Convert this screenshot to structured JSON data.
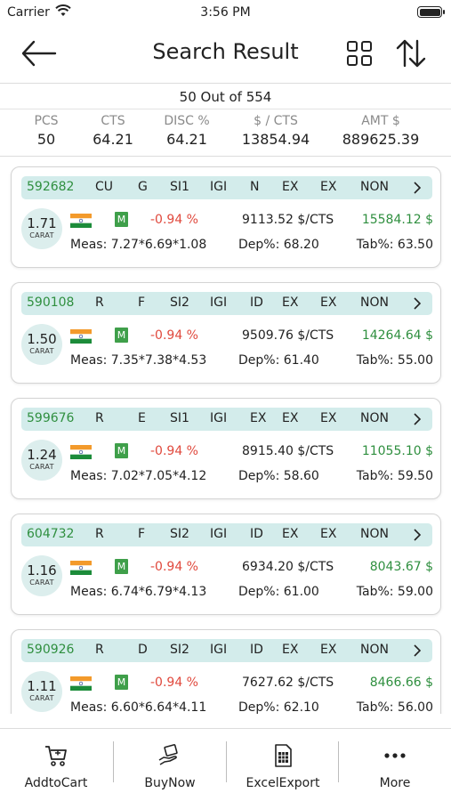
{
  "status_bar": {
    "carrier": "Carrier",
    "time": "3:56 PM"
  },
  "header": {
    "title": "Search Result"
  },
  "summary": {
    "count_text": "50 Out of 554",
    "stats": [
      {
        "label": "PCS",
        "value": "50"
      },
      {
        "label": "CTS",
        "value": "64.21"
      },
      {
        "label": "DISC %",
        "value": "64.21"
      },
      {
        "label": "$ / CTS",
        "value": "13854.94"
      },
      {
        "label": "AMT $",
        "value": "889625.39"
      }
    ]
  },
  "results": [
    {
      "stock": "592682",
      "shape": "CU",
      "color": "G",
      "clarity": "SI1",
      "lab": "IGI",
      "cut": "N",
      "polish": "EX",
      "symmetry": "EX",
      "fluorescence": "NON",
      "carat": "1.71",
      "carat_unit": "CARAT",
      "badge": "M",
      "discount": "-0.94 %",
      "price_per_carat": "9113.52 $/CTS",
      "amount": "15584.12 $",
      "measurements": "Meas: 7.27*6.69*1.08",
      "depth": "Dep%: 68.20",
      "table": "Tab%: 63.50"
    },
    {
      "stock": "590108",
      "shape": "R",
      "color": "F",
      "clarity": "SI2",
      "lab": "IGI",
      "cut": "ID",
      "polish": "EX",
      "symmetry": "EX",
      "fluorescence": "NON",
      "carat": "1.50",
      "carat_unit": "CARAT",
      "badge": "M",
      "discount": "-0.94 %",
      "price_per_carat": "9509.76 $/CTS",
      "amount": "14264.64 $",
      "measurements": "Meas: 7.35*7.38*4.53",
      "depth": "Dep%: 61.40",
      "table": "Tab%: 55.00"
    },
    {
      "stock": "599676",
      "shape": "R",
      "color": "E",
      "clarity": "SI1",
      "lab": "IGI",
      "cut": "EX",
      "polish": "EX",
      "symmetry": "EX",
      "fluorescence": "NON",
      "carat": "1.24",
      "carat_unit": "CARAT",
      "badge": "M",
      "discount": "-0.94 %",
      "price_per_carat": "8915.40 $/CTS",
      "amount": "11055.10 $",
      "measurements": "Meas: 7.02*7.05*4.12",
      "depth": "Dep%: 58.60",
      "table": "Tab%: 59.50"
    },
    {
      "stock": "604732",
      "shape": "R",
      "color": "F",
      "clarity": "SI2",
      "lab": "IGI",
      "cut": "ID",
      "polish": "EX",
      "symmetry": "EX",
      "fluorescence": "NON",
      "carat": "1.16",
      "carat_unit": "CARAT",
      "badge": "M",
      "discount": "-0.94 %",
      "price_per_carat": "6934.20 $/CTS",
      "amount": "8043.67 $",
      "measurements": "Meas: 6.74*6.79*4.13",
      "depth": "Dep%: 61.00",
      "table": "Tab%: 59.00"
    },
    {
      "stock": "590926",
      "shape": "R",
      "color": "D",
      "clarity": "SI2",
      "lab": "IGI",
      "cut": "ID",
      "polish": "EX",
      "symmetry": "EX",
      "fluorescence": "NON",
      "carat": "1.11",
      "carat_unit": "CARAT",
      "badge": "M",
      "discount": "-0.94 %",
      "price_per_carat": "7627.62 $/CTS",
      "amount": "8466.66 $",
      "measurements": "Meas: 6.60*6.64*4.11",
      "depth": "Dep%: 62.10",
      "table": "Tab%: 56.00"
    }
  ],
  "tabbar": {
    "items": [
      {
        "label": "AddtoCart",
        "icon": "cart-icon"
      },
      {
        "label": "BuyNow",
        "icon": "buy-icon"
      },
      {
        "label": "ExcelExport",
        "icon": "excel-icon"
      },
      {
        "label": "More",
        "icon": "more-icon"
      }
    ]
  },
  "colors": {
    "accent_green": "#2f8f3f",
    "discount_red": "#e0493d",
    "strip_bg": "#d3eceb"
  }
}
